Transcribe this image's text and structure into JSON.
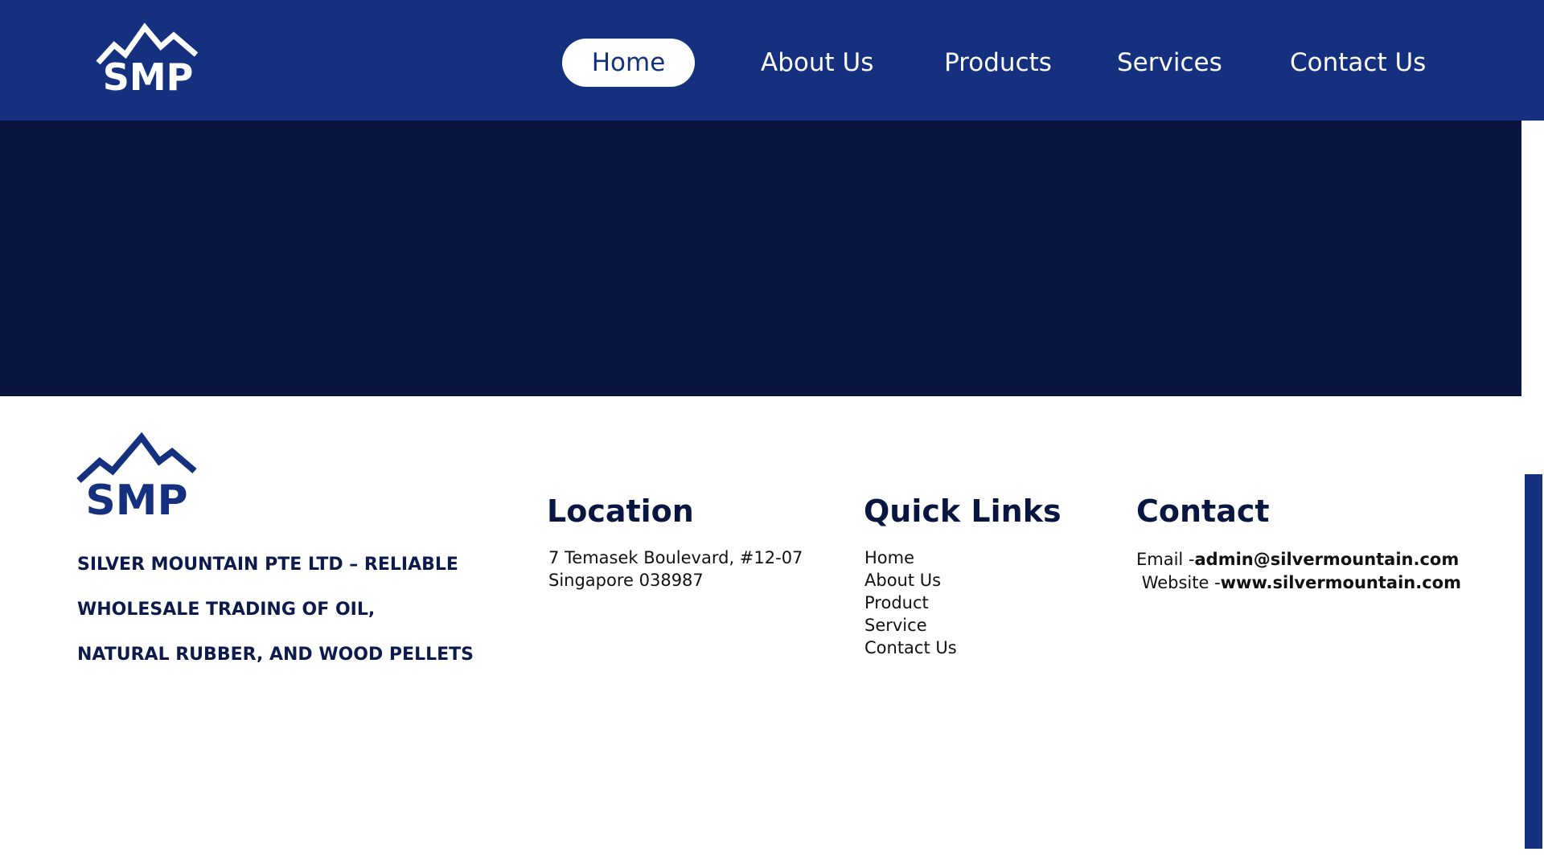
{
  "brand": {
    "logo_text": "SMP",
    "primary_color": "#14307f",
    "dark_color": "#091641"
  },
  "nav": {
    "items": [
      {
        "label": "Home",
        "active": true
      },
      {
        "label": "About Us"
      },
      {
        "label": "Products"
      },
      {
        "label": "Services"
      },
      {
        "label": "Contact Us"
      }
    ]
  },
  "footer": {
    "tagline": [
      "SILVER MOUNTAIN PTE LTD – RELIABLE",
      "WHOLESALE TRADING OF OIL,",
      "NATURAL RUBBER, AND WOOD PELLETS"
    ],
    "location": {
      "heading": "Location",
      "lines": [
        "7 Temasek Boulevard, #12-07",
        "Singapore 038987"
      ]
    },
    "quick_links": {
      "heading": "Quick Links",
      "items": [
        "Home",
        "About Us",
        "Product",
        "Service",
        "Contact Us"
      ]
    },
    "contact": {
      "heading": "Contact",
      "email_label": "Email -",
      "email": "admin@silvermountain.com",
      "website_label": "Website -",
      "website": "www.silvermountain.com"
    }
  }
}
